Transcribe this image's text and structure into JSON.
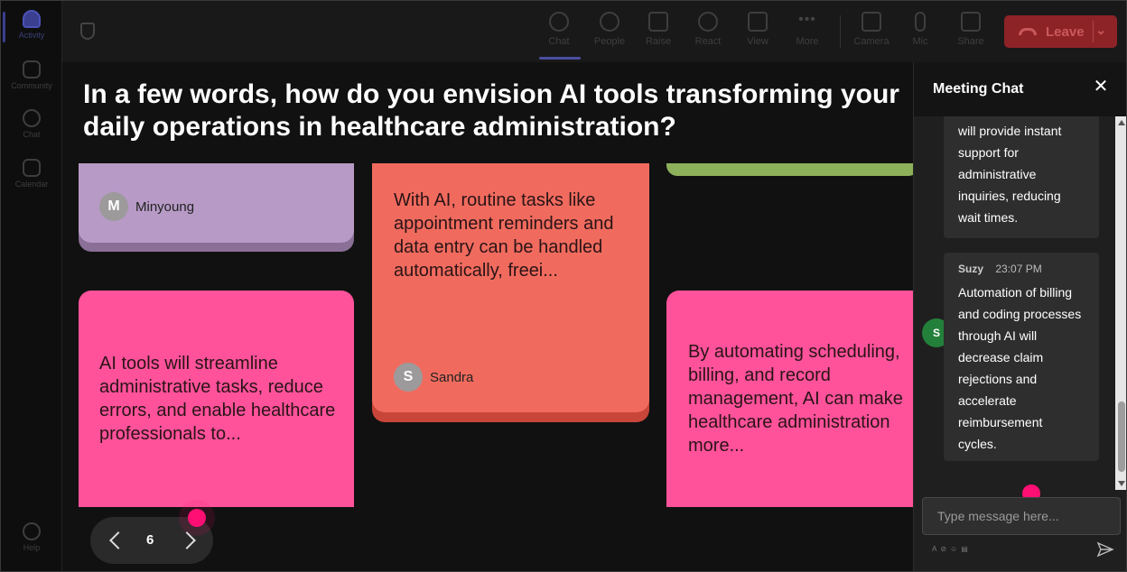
{
  "rail": {
    "items": [
      {
        "label": "Activity",
        "icon": "bell-icon"
      },
      {
        "label": "Community",
        "icon": "community-icon"
      },
      {
        "label": "Chat",
        "icon": "chat-icon"
      },
      {
        "label": "Calendar",
        "icon": "calendar-icon"
      },
      {
        "label": "Help",
        "icon": "help-icon"
      }
    ]
  },
  "toolbar": {
    "chat": "Chat",
    "people": "People",
    "raise": "Raise",
    "react": "React",
    "view": "View",
    "more": "More",
    "camera": "Camera",
    "mic": "Mic",
    "share": "Share",
    "leave": "Leave"
  },
  "stage": {
    "question": "In a few words, how do you envision AI tools transforming your daily operations in healthcare administration?",
    "cards": [
      {
        "author": "Minyoung",
        "initial": "M",
        "color": "#b79ac6"
      },
      {
        "text": "With AI, routine tasks like appointment reminders and data entry can be handled automatically, freei...",
        "author": "Sandra",
        "initial": "S",
        "color": "#f06b5e"
      },
      {
        "color": "#8db05a"
      },
      {
        "text": "AI tools will streamline administrative tasks, reduce errors, and enable healthcare professionals to...",
        "color": "#ff529b"
      },
      {
        "text": "By automating scheduling, billing, and record management, AI can make healthcare administration more...",
        "color": "#ff529b"
      }
    ],
    "pager": {
      "page": "6"
    }
  },
  "chat": {
    "title": "Meeting Chat",
    "messages": [
      {
        "text": "will provide instant support for administrative inquiries, reducing wait times."
      },
      {
        "author": "Suzy",
        "initial": "S",
        "time": "23:07 PM",
        "text": "Automation of billing and coding processes through AI will decrease claim rejections and accelerate reimbursement cycles."
      }
    ],
    "input_placeholder": "Type message here..."
  }
}
